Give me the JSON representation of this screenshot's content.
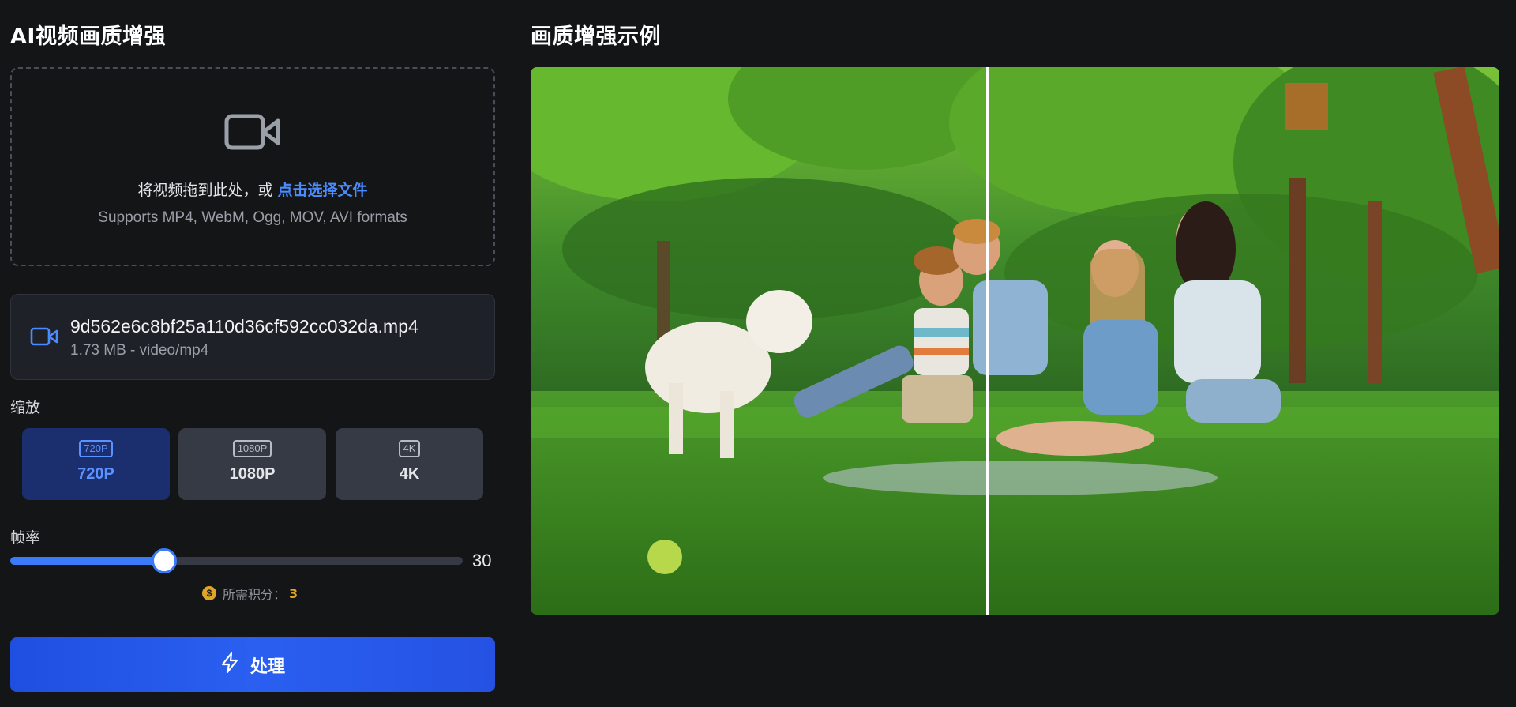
{
  "left_panel": {
    "title": "AI视频画质增强",
    "dropzone": {
      "icon": "video-camera-icon",
      "prompt": "将视频拖到此处，或 ",
      "link": "点击选择文件",
      "formats": "Supports MP4, WebM, Ogg, MOV, AVI formats"
    },
    "file": {
      "icon": "video-camera-icon",
      "name": "9d562e6c8bf25a110d36cf592cc032da.mp4",
      "meta": "1.73 MB - video/mp4"
    },
    "scale": {
      "label": "缩放",
      "options": [
        {
          "badge": "720P",
          "label": "720P",
          "selected": true
        },
        {
          "badge": "1080P",
          "label": "1080P",
          "selected": false
        },
        {
          "badge": "4K",
          "label": "4K",
          "selected": false
        }
      ]
    },
    "framerate": {
      "label": "帧率",
      "value": "30",
      "fill_fraction": 0.34
    },
    "credits": {
      "icon": "dollar-coin-icon",
      "label": "所需积分：",
      "value": "3"
    },
    "process_button": {
      "icon": "lightning-bolt-icon",
      "label": "处理"
    }
  },
  "right_panel": {
    "title": "画质增强示例",
    "preview": {
      "split_fraction": 0.47
    }
  },
  "colors": {
    "background": "#141517",
    "accent": "#3a7bfa",
    "selected_option": "#1b2f6e",
    "credit": "#e0a526"
  }
}
